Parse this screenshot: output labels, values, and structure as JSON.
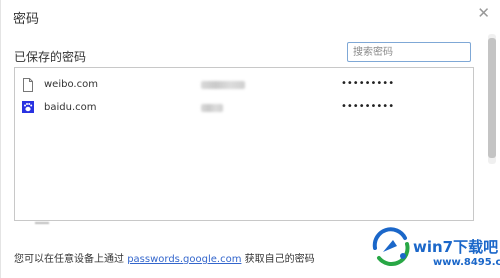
{
  "dialog": {
    "title": "密码",
    "close_glyph": "✕"
  },
  "saved": {
    "section_title": "已保存的密码",
    "search_placeholder": "搜索密码",
    "entries": [
      {
        "site": "weibo.com",
        "icon": "page-icon",
        "password": "•••••••••"
      },
      {
        "site": "baidu.com",
        "icon": "baidu-paw-icon",
        "password": "•••••••••"
      }
    ]
  },
  "footer": {
    "prefix": "您可以在任意设备上通过",
    "link": "passwords.google.com",
    "suffix": "获取自己的密码"
  },
  "watermark": {
    "title": "win7下载吧",
    "url": "www.8495.com"
  },
  "colors": {
    "link": "#3366cc",
    "accent": "#1b67c9",
    "baidu_blue": "#2932e1"
  }
}
